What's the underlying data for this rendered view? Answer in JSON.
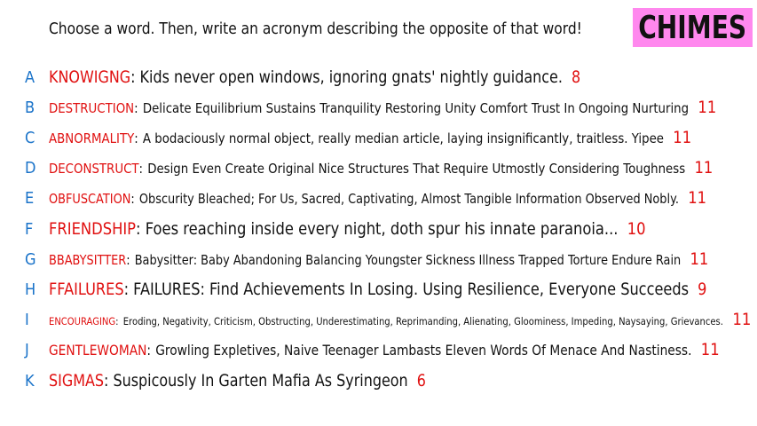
{
  "header": {
    "prompt": "Choose a word. Then, write an acronym describing the opposite of that word!",
    "brand": "CHIMES"
  },
  "entries": [
    {
      "letter": "A",
      "word": "KNOWIGNG",
      "acronym": "Kids never open windows, ignoring gnats' nightly guidance.",
      "count": "8"
    },
    {
      "letter": "B",
      "word": "DESTRUCTION",
      "acronym": "Delicate Equilibrium Sustains Tranquility Restoring Unity Comfort Trust In Ongoing Nurturing",
      "count": "11"
    },
    {
      "letter": "C",
      "word": "ABNORMALITY",
      "acronym": "A bodaciously normal object, really median article, laying insignificantly, traitless. Yipee",
      "count": "11"
    },
    {
      "letter": "D",
      "word": "DECONSTRUCT",
      "acronym": "Design Even Create Original Nice Structures That Require Utmostly Considering Toughness",
      "count": "11"
    },
    {
      "letter": "E",
      "word": "OBFUSCATION",
      "acronym": "Obscurity Bleached; For Us, Sacred, Captivating, Almost Tangible Information Observed Nobly.",
      "count": "11"
    },
    {
      "letter": "F",
      "word": "FRIENDSHIP",
      "acronym": "Foes reaching inside every night, doth spur his innate paranoia...",
      "count": "10"
    },
    {
      "letter": "G",
      "word": "BBABYSITTER",
      "acronym": "Babysitter: Baby Abandoning Balancing Youngster Sickness Illness Trapped Torture Endure Rain",
      "count": "11"
    },
    {
      "letter": "H",
      "word": "FFAILURES",
      "acronym": "FAILURES: Find Achievements In Losing. Using Resilience, Everyone Succeeds",
      "count": "9"
    },
    {
      "letter": "I",
      "word": "ENCOURAGING",
      "acronym": "Eroding, Negativity, Criticism, Obstructing, Underestimating, Reprimanding, Alienating, Gloominess, Impeding, Naysaying, Grievances.",
      "count": "11"
    },
    {
      "letter": "J",
      "word": "GENTLEWOMAN",
      "acronym": "Growling Expletives, Naive Teenager Lambasts Eleven Words Of Menace And Nastiness.",
      "count": "11"
    },
    {
      "letter": "K",
      "word": "SIGMAS",
      "acronym": "Suspicously In Garten Mafia As Syringeon",
      "count": "6"
    }
  ]
}
